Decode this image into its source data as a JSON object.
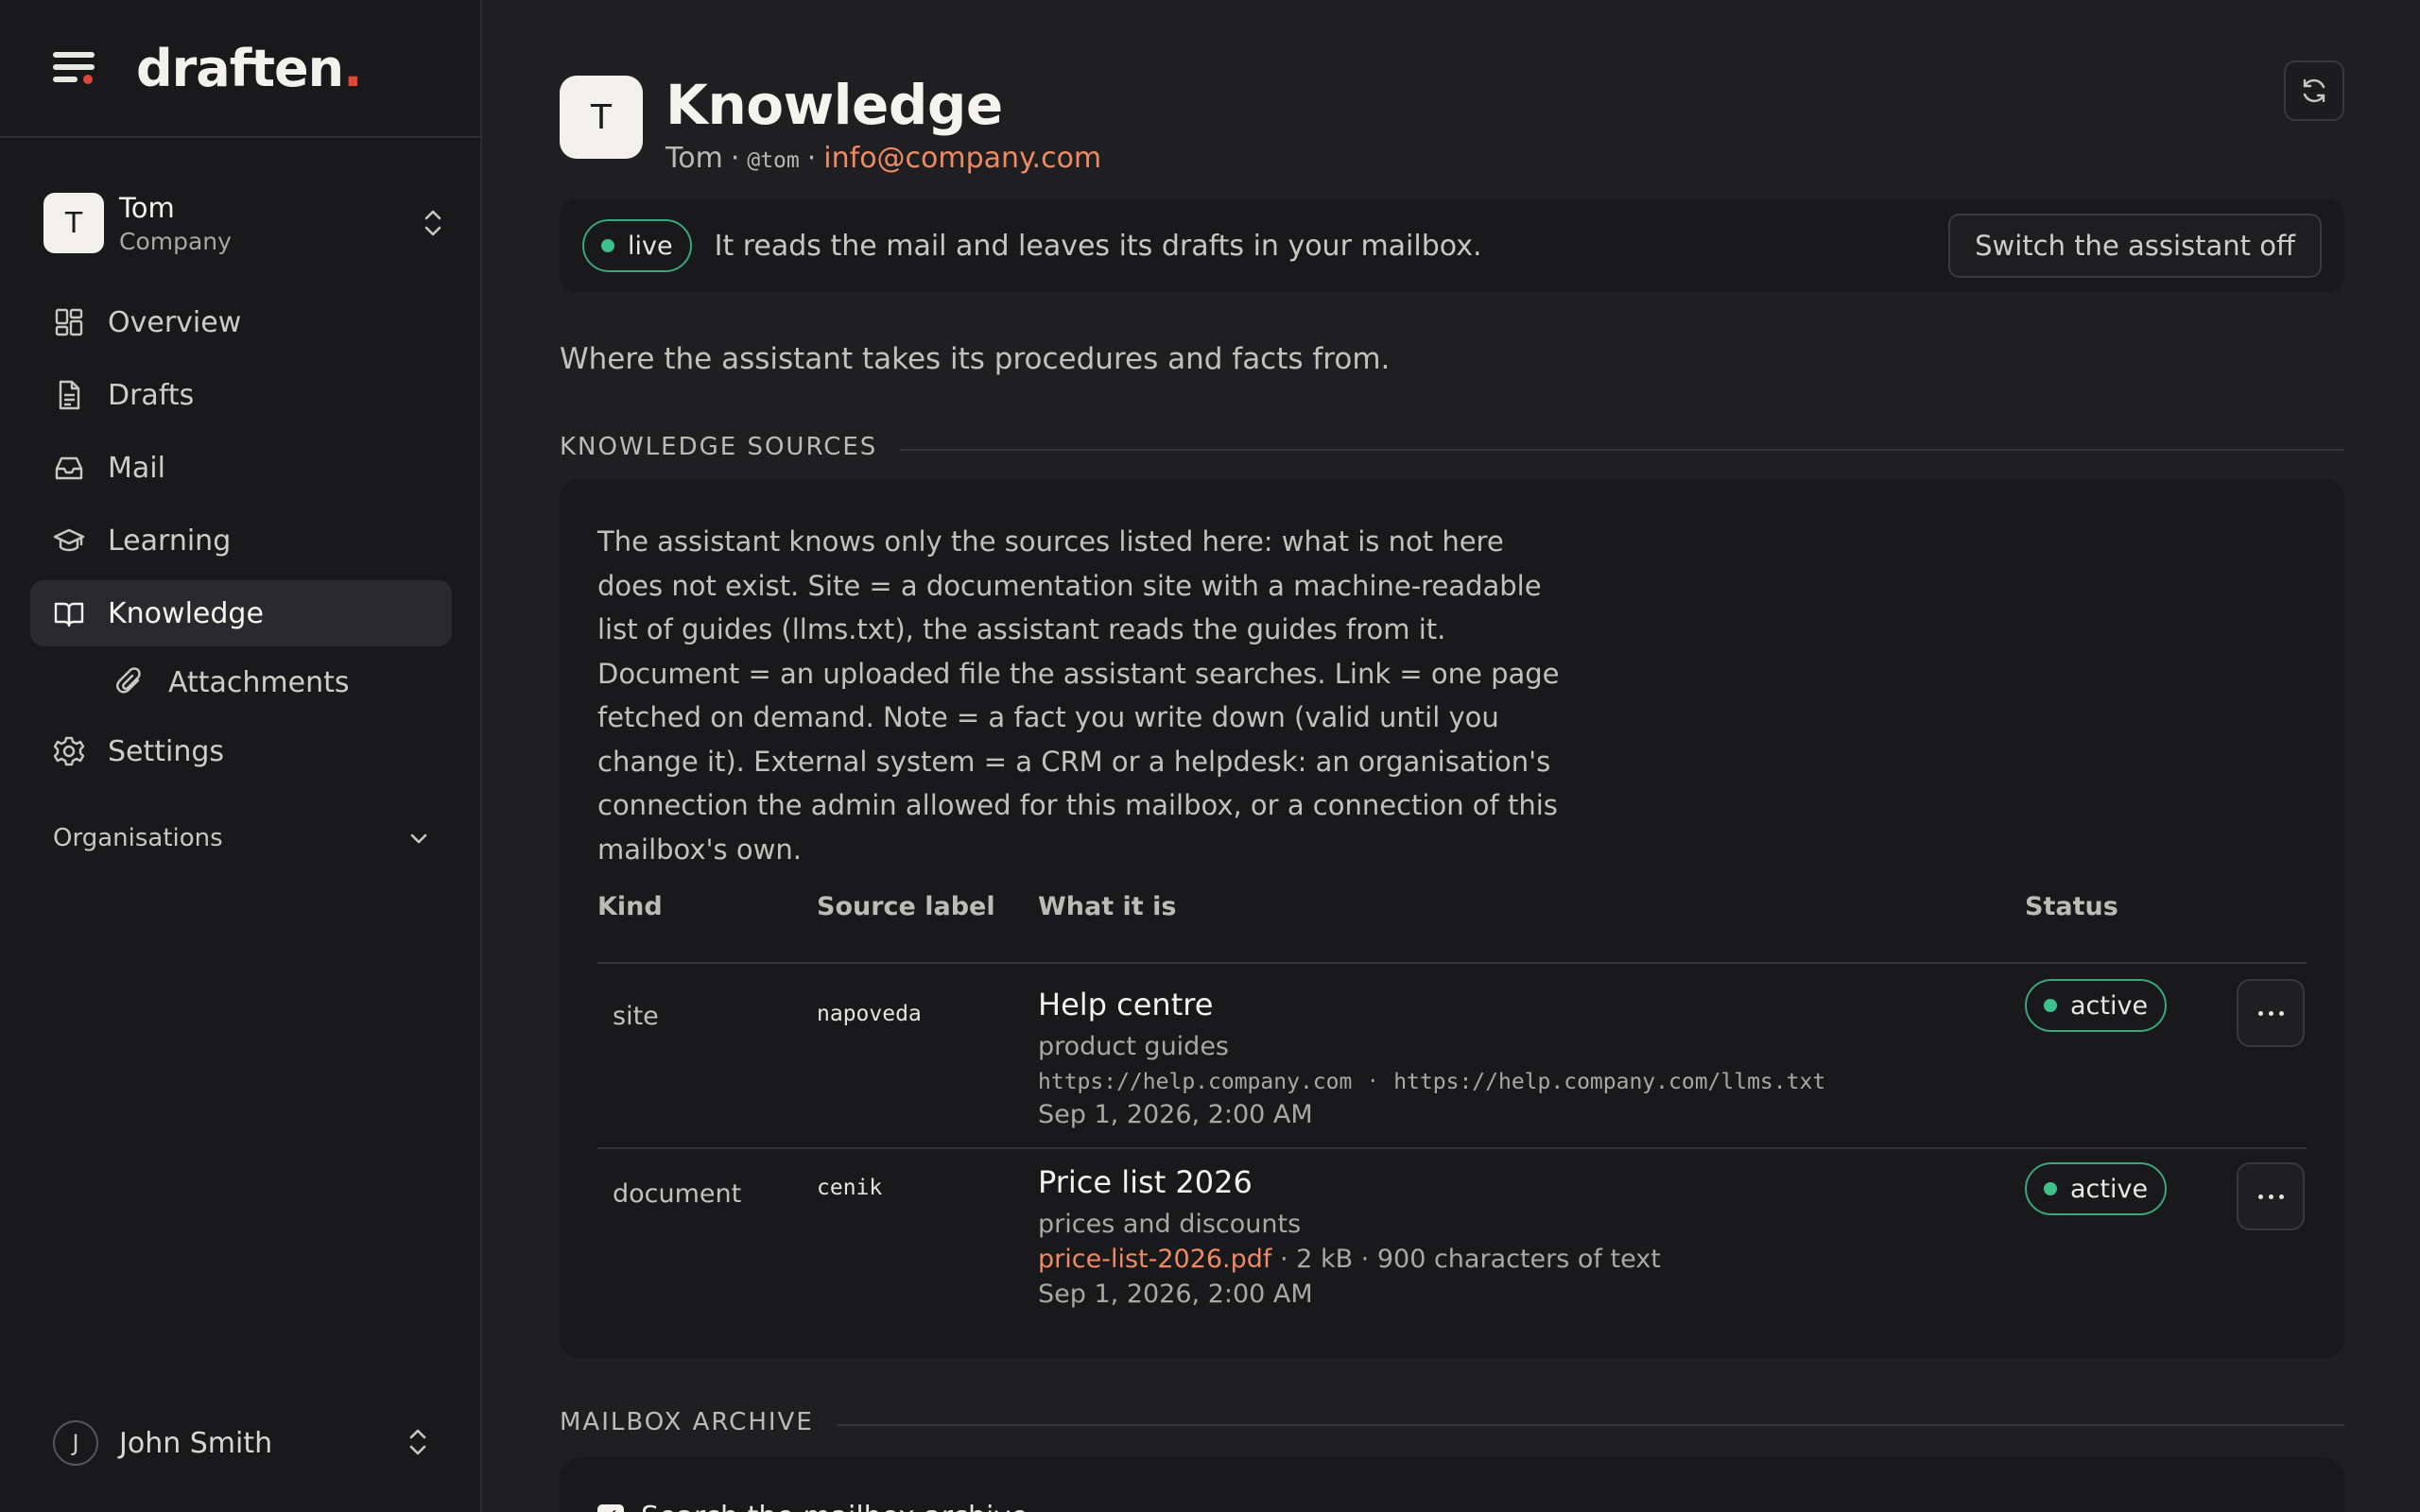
{
  "app": {
    "logo": "draften",
    "logo_dot": ".",
    "accent": "#e0473b",
    "link_color": "#f08a63",
    "live_color": "#3fbf8c"
  },
  "account": {
    "initial": "T",
    "name": "Tom",
    "org": "Company"
  },
  "nav": {
    "items": [
      {
        "label": "Overview",
        "icon": "grid-icon"
      },
      {
        "label": "Drafts",
        "icon": "document-icon"
      },
      {
        "label": "Mail",
        "icon": "inbox-icon"
      },
      {
        "label": "Learning",
        "icon": "graduation-cap-icon"
      },
      {
        "label": "Knowledge",
        "icon": "book-icon",
        "active": true
      },
      {
        "label": "Attachments",
        "icon": "paperclip-icon",
        "sub": true
      },
      {
        "label": "Settings",
        "icon": "gear-icon"
      }
    ],
    "organisations": "Organisations"
  },
  "user": {
    "initial": "J",
    "name": "John Smith"
  },
  "header": {
    "initial": "T",
    "title": "Knowledge",
    "name": "Tom",
    "separator": "·",
    "handle": "@tom",
    "email": "info@company.com"
  },
  "status": {
    "badge": "live",
    "text": "It reads the mail and leaves its drafts in your mailbox.",
    "button": "Switch the assistant off"
  },
  "intro": "Where the assistant takes its procedures and facts from.",
  "sources": {
    "heading": "KNOWLEDGE SOURCES",
    "explanation": "The assistant knows only the sources listed here: what is not here does not exist. Site = a documentation site with a machine-readable list of guides (llms.txt), the assistant reads the guides from it. Document = an uploaded file the assistant searches. Link = one page fetched on demand. Note = a fact you write down (valid until you change it). External system = a CRM or a helpdesk: an organisation's connection the admin allowed for this mailbox, or a connection of this mailbox's own.",
    "columns": {
      "kind": "Kind",
      "label": "Source label",
      "what": "What it is",
      "status": "Status"
    },
    "rows": [
      {
        "kind": "site",
        "label": "napoveda",
        "title": "Help centre",
        "desc": "product guides",
        "url1": "https://help.company.com",
        "url_sep": "·",
        "url2": "https://help.company.com/llms.txt",
        "date": "Sep 1, 2026, 2:00 AM",
        "status": "active"
      },
      {
        "kind": "document",
        "label": "cenik",
        "title": "Price list 2026",
        "desc": "prices and discounts",
        "file": "price-list-2026.pdf",
        "size": "· 2 kB · 900 characters of text",
        "date": "Sep 1, 2026, 2:00 AM",
        "status": "active"
      }
    ]
  },
  "archive": {
    "heading": "MAILBOX ARCHIVE",
    "checkbox_label": "Search the mailbox archive"
  }
}
